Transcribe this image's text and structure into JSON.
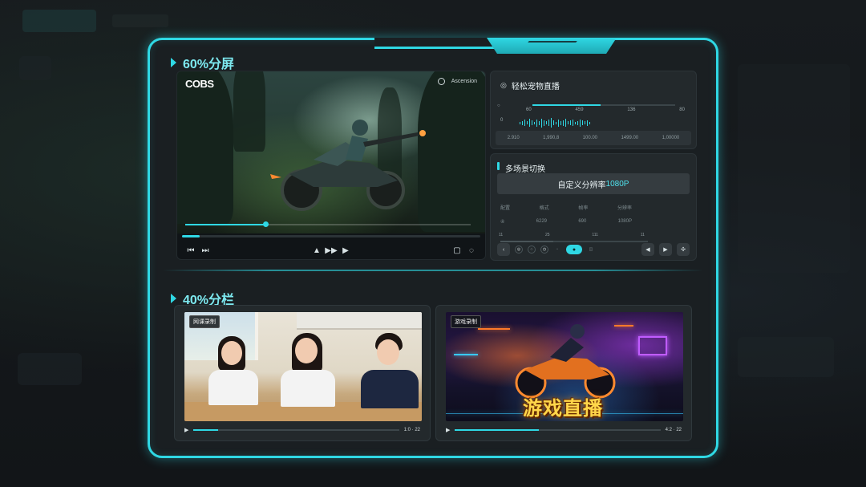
{
  "top_section": {
    "title": "60%分屏"
  },
  "bottom_section": {
    "title": "40%分栏"
  },
  "video": {
    "logo": "COBS",
    "top_right_label": "Ascension",
    "progress": 0.28,
    "main_progress": 0.06
  },
  "live_panel": {
    "title": "轻松宠物直播",
    "slider_value": 0.48,
    "slider_labels": [
      "60",
      "459",
      "136",
      "80"
    ],
    "row_labels": [
      "○",
      "0"
    ],
    "stats": [
      "2.910",
      "1,990,8",
      "100.00",
      "1499.00",
      "1,00000"
    ]
  },
  "scene_panel": {
    "title": "多场景切换",
    "resolution_prefix": "自定义分辨率",
    "resolution_value": "1080P",
    "grid_header": [
      "配置",
      "格式",
      "帧率",
      "分辨率"
    ],
    "grid_values": [
      "④",
      "6229",
      "690",
      "1080P"
    ],
    "track_labels": [
      "11",
      "25",
      "111",
      "11"
    ]
  },
  "cards": [
    {
      "tag": "网课录制",
      "time": "1:0 · 22",
      "progress": 0.12
    },
    {
      "tag": "游戏录制",
      "overlay_text": "游戏直播",
      "time": "4:2 · 22",
      "progress": 0.41
    }
  ],
  "colors": {
    "accent": "#2fd8e4",
    "frame_bg": "#1a1f22",
    "card_bg": "#23292c"
  },
  "icons": {
    "prev": "⏮",
    "next": "⏭",
    "volume": "▲",
    "speed": "▶▶",
    "play": "▶",
    "caption": "▢",
    "settings": "◌"
  }
}
